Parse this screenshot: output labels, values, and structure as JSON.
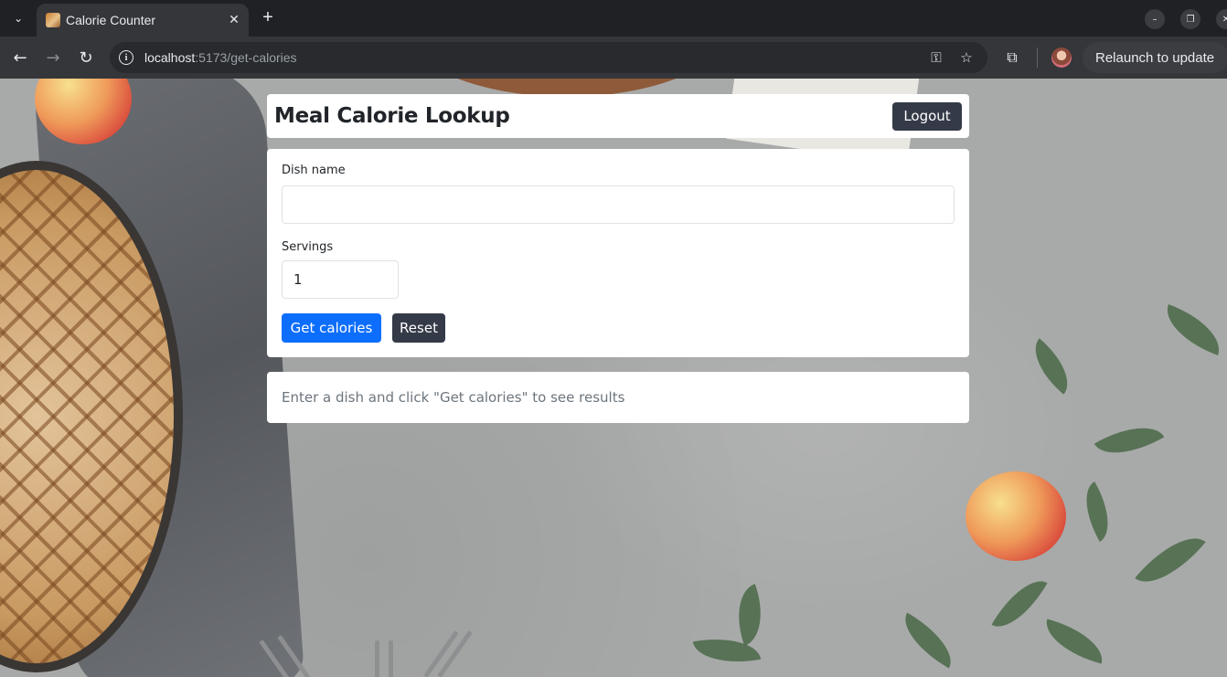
{
  "browser": {
    "tab_title": "Calorie Counter",
    "tab_close": "✕",
    "new_tab": "+",
    "url_host": "localhost",
    "url_rest": ":5173/get-calories",
    "relaunch_label": "Relaunch to update",
    "icons": {
      "back": "←",
      "forward": "→",
      "reload": "↻",
      "key": "⚿",
      "star": "☆",
      "extensions": "⧉",
      "tab_search": "⌄",
      "minimize": "–",
      "restore": "❐",
      "close": "✕"
    }
  },
  "app": {
    "title": "Meal Calorie Lookup",
    "logout_label": "Logout",
    "form": {
      "dish_label": "Dish name",
      "dish_value": "",
      "servings_label": "Servings",
      "servings_value": "1",
      "submit_label": "Get calories",
      "reset_label": "Reset"
    },
    "result_placeholder": "Enter a dish and click \"Get calories\" to see results"
  },
  "colors": {
    "primary": "#0d6efd",
    "dark_button": "#343a47",
    "muted_text": "#6c757d"
  }
}
